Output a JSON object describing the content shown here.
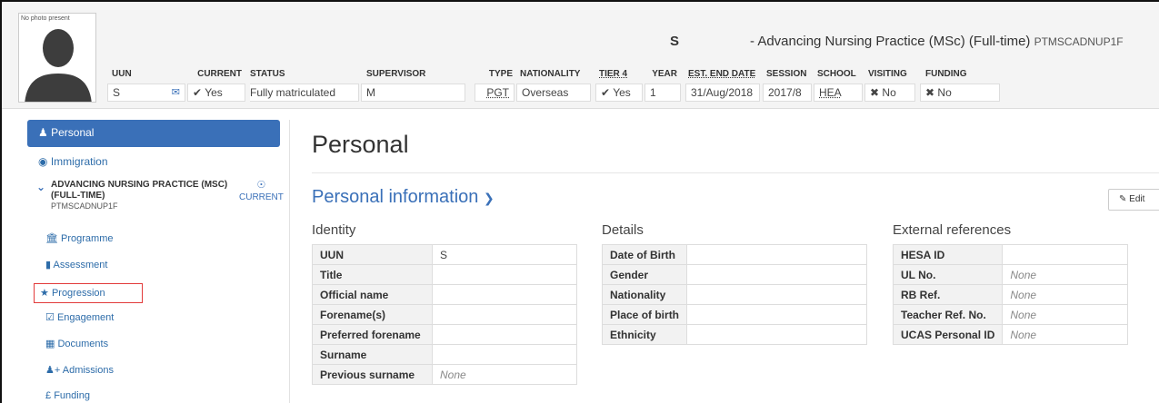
{
  "header": {
    "photo_text": "No photo present",
    "student_name": "S",
    "programme": "- Advancing Nursing Practice (MSc) (Full-time)",
    "programme_code": "PTMSCADNUP1F",
    "fields": {
      "uun": {
        "label": "UUN",
        "value": "S"
      },
      "current": {
        "label": "CURRENT",
        "value": "Yes"
      },
      "status": {
        "label": "STATUS",
        "value": "Fully matriculated"
      },
      "supervisor": {
        "label": "SUPERVISOR",
        "value": "M"
      },
      "type": {
        "label": "TYPE",
        "value": "PGT"
      },
      "nationality": {
        "label": "NATIONALITY",
        "value": "Overseas"
      },
      "tier4": {
        "label": "TIER 4",
        "value": "Yes"
      },
      "year": {
        "label": "YEAR",
        "value": "1"
      },
      "est_end_date": {
        "label": "EST. END DATE",
        "value": "31/Aug/2018"
      },
      "session": {
        "label": "SESSION",
        "value": "2017/8"
      },
      "school": {
        "label": "SCHOOL",
        "value": "HEA"
      },
      "visiting": {
        "label": "VISITING",
        "value": "No"
      },
      "funding": {
        "label": "FUNDING",
        "value": "No"
      }
    }
  },
  "sidebar": {
    "personal": "Personal",
    "immigration": "Immigration",
    "programme_heading": "ADVANCING NURSING PRACTICE (MSC) (FULL-TIME)",
    "programme_code": "PTMSCADNUP1F",
    "current_label": "CURRENT",
    "items": {
      "programme": "Programme",
      "assessment": "Assessment",
      "progression": "Progression",
      "engagement": "Engagement",
      "documents": "Documents",
      "admissions": "Admissions",
      "funding": "Funding"
    }
  },
  "main": {
    "page_title": "Personal",
    "section_title": "Personal information",
    "edit_label": "Edit",
    "identity": {
      "title": "Identity",
      "rows": [
        {
          "label": "UUN",
          "value": "S"
        },
        {
          "label": "Title",
          "value": ""
        },
        {
          "label": "Official name",
          "value": ""
        },
        {
          "label": "Forename(s)",
          "value": ""
        },
        {
          "label": "Preferred forename",
          "value": ""
        },
        {
          "label": "Surname",
          "value": ""
        },
        {
          "label": "Previous surname",
          "value": "None"
        }
      ]
    },
    "details": {
      "title": "Details",
      "rows": [
        {
          "label": "Date of Birth",
          "value": ""
        },
        {
          "label": "Gender",
          "value": ""
        },
        {
          "label": "Nationality",
          "value": ""
        },
        {
          "label": "Place of birth",
          "value": ""
        },
        {
          "label": "Ethnicity",
          "value": ""
        }
      ]
    },
    "external": {
      "title": "External references",
      "rows": [
        {
          "label": "HESA ID",
          "value": ""
        },
        {
          "label": "UL No.",
          "value": "None"
        },
        {
          "label": "RB Ref.",
          "value": "None"
        },
        {
          "label": "Teacher Ref. No.",
          "value": "None"
        },
        {
          "label": "UCAS Personal ID",
          "value": "None"
        }
      ]
    }
  },
  "colors": {
    "accent": "#3a70b8",
    "highlight_border": "#e23b3b"
  },
  "icons": [
    "user-icon",
    "globe-icon",
    "chevron-down-icon",
    "target-icon",
    "bank-icon",
    "book-icon",
    "star-icon",
    "checkbox-icon",
    "file-icon",
    "users-add-icon",
    "pound-icon",
    "envelope-icon",
    "check-icon",
    "cross-icon",
    "pencil-icon"
  ]
}
